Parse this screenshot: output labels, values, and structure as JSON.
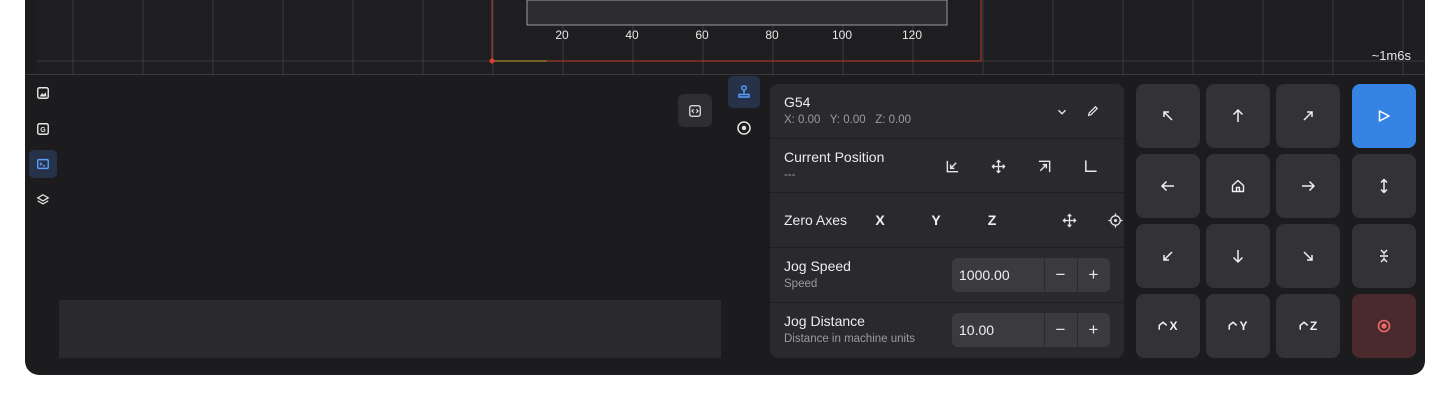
{
  "canvas": {
    "x_ticks": [
      "20",
      "40",
      "60",
      "80",
      "100",
      "120"
    ],
    "eta": "~1m6s"
  },
  "left_rail": {
    "items": [
      {
        "icon": "image-icon",
        "active": false
      },
      {
        "icon": "gcode-icon",
        "active": false
      },
      {
        "icon": "terminal-icon",
        "active": true
      },
      {
        "icon": "layers-icon",
        "active": false
      }
    ]
  },
  "mid_rail": {
    "items": [
      {
        "icon": "joystick-icon",
        "active": true
      },
      {
        "icon": "probe-icon",
        "active": false
      }
    ]
  },
  "wcs": {
    "name": "G54",
    "x": "X: 0.00",
    "y": "Y: 0.00",
    "z": "Z: 0.00"
  },
  "current_position": {
    "title": "Current Position",
    "value": "---"
  },
  "zero_axes": {
    "title": "Zero Axes",
    "x": "X",
    "y": "Y",
    "z": "Z"
  },
  "jog_speed": {
    "title": "Jog Speed",
    "subtitle": "Speed",
    "value": "1000.00",
    "minus": "−",
    "plus": "+"
  },
  "jog_distance": {
    "title": "Jog Distance",
    "subtitle": "Distance in machine units",
    "value": "10.00",
    "minus": "−",
    "plus": "+"
  },
  "home_buttons": {
    "x": "X",
    "y": "Y",
    "z": "Z"
  },
  "colors": {
    "accent": "#3584e4",
    "danger_bg": "#4a2a2c",
    "danger_fg": "#f06a6a",
    "active_rail": "#25324a"
  }
}
